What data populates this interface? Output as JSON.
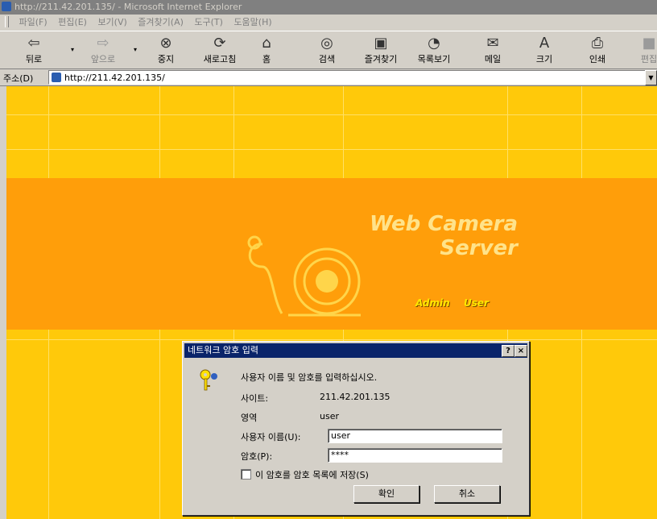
{
  "window": {
    "title": "http://211.42.201.135/ - Microsoft Internet Explorer"
  },
  "menu": [
    "파일(F)",
    "편집(E)",
    "보기(V)",
    "즐겨찾기(A)",
    "도구(T)",
    "도움말(H)"
  ],
  "toolbar": {
    "back": "뒤로",
    "forward": "앞으로",
    "stop": "중지",
    "refresh": "새로고침",
    "home": "홈",
    "search": "검색",
    "favorites": "즐겨찾기",
    "history": "목록보기",
    "mail": "메일",
    "size": "크기",
    "print": "인쇄",
    "edit": "편집"
  },
  "address": {
    "label": "주소(D)",
    "url": "http://211.42.201.135/"
  },
  "page": {
    "title_line1": "Web Camera",
    "title_line2": "Server",
    "admin_link": "Admin",
    "user_link": "User",
    "colors": {
      "background": "#ffc90a",
      "banner": "#ff9e0a",
      "title": "#ffe38a",
      "link": "#ffe800"
    }
  },
  "dialog": {
    "title": "네트워크 암호 입력",
    "help_button": "?",
    "close_button": "×",
    "prompt": "사용자 이름 및 암호를 입력하십시오.",
    "site_label": "사이트:",
    "site_value": "211.42.201.135",
    "realm_label": "영역",
    "realm_value": "user",
    "username_label": "사용자 이름(U):",
    "username_value": "user",
    "password_label": "암호(P):",
    "password_value": "****",
    "save_password_label": "이 암호를 암호 목록에 저장(S)",
    "save_password_checked": false,
    "ok_button": "확인",
    "cancel_button": "취소"
  }
}
